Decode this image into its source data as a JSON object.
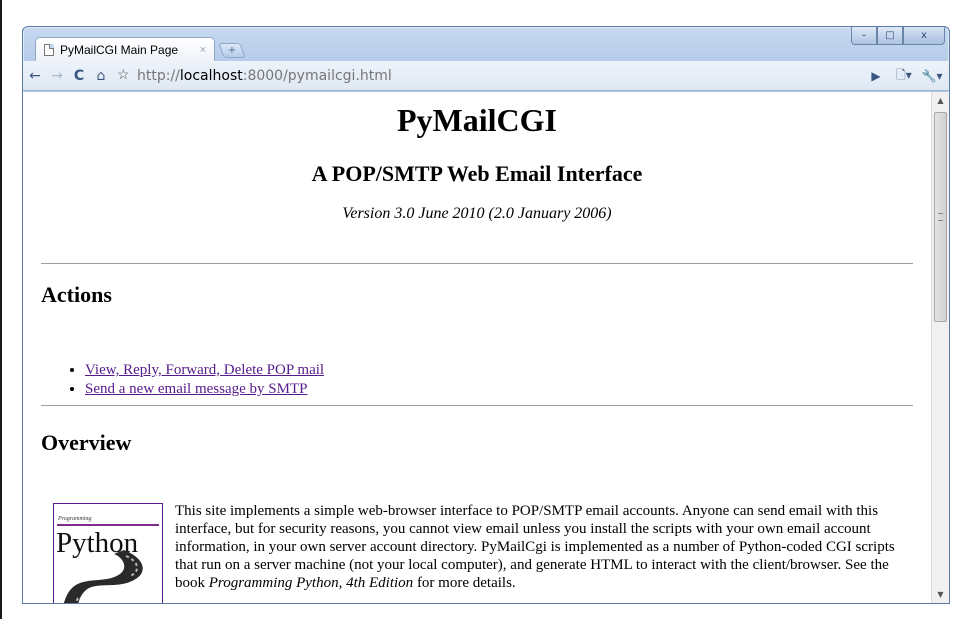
{
  "browser": {
    "tab_title": "PyMailCGI Main Page",
    "tab_close": "×",
    "new_tab": "+",
    "url_scheme": "http://",
    "url_host": "localhost",
    "url_rest": ":8000/pymailcgi.html",
    "controls": {
      "minimize": "–",
      "maximize": "□",
      "close": "x"
    },
    "icons": [
      "back-icon",
      "forward-icon",
      "reload-icon",
      "home-icon",
      "star-icon",
      "go-icon",
      "page-menu-icon",
      "wrench-icon"
    ]
  },
  "page": {
    "title": "PyMailCGI",
    "subtitle": "A POP/SMTP Web Email Interface",
    "version": "Version 3.0 June 2010 (2.0 January 2006)",
    "actions_heading": "Actions",
    "actions": [
      {
        "label": "View, Reply, Forward, Delete POP mail"
      },
      {
        "label": "Send a new email message by SMTP"
      }
    ],
    "overview_heading": "Overview",
    "book_cover": {
      "header": "Programming",
      "word": "Python"
    },
    "overview_text_before": "This site implements a simple web-browser interface to POP/SMTP email accounts. Anyone can send email with this interface, but for security reasons, you cannot view email unless you install the scripts with your own email account information, in your own server account directory. PyMailCgi is implemented as a number of Python-coded CGI scripts that run on a server machine (not your local computer), and generate HTML to interact with the client/browser. See the book ",
    "overview_text_italic": "Programming Python, 4th Edition",
    "overview_text_after": " for more details."
  },
  "colors": {
    "visited_link": "#551a8b",
    "window_frame": "#b7cce9"
  }
}
